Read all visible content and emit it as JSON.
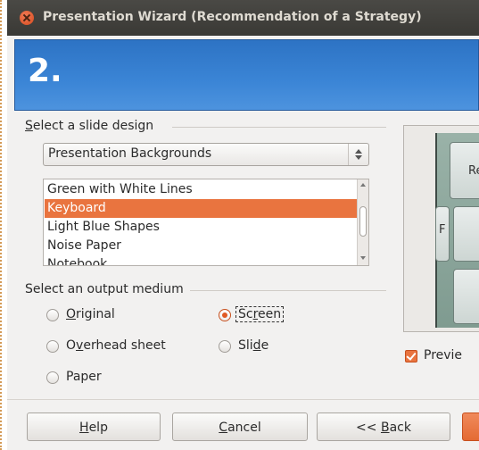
{
  "window": {
    "title": "Presentation Wizard (Recommendation of a Strategy)"
  },
  "banner": {
    "step": "2."
  },
  "slide_design": {
    "group_label": "Select a slide design",
    "group_label_mnemonic": "S",
    "group_label_rest": "elect a slide design",
    "category_selected": "Presentation Backgrounds",
    "items": [
      "Green with White Lines",
      "Keyboard",
      "Light Blue Shapes",
      "Noise Paper",
      "Notebook"
    ],
    "selected_item": "Keyboard"
  },
  "output_medium": {
    "group_label": "Select an output medium",
    "options": [
      {
        "label": "Original",
        "mnemonic": "O",
        "rest": "riginal",
        "checked": false
      },
      {
        "label": "Overhead sheet",
        "pre": "O",
        "mnemonic": "v",
        "rest": "erhead sheet",
        "checked": false
      },
      {
        "label": "Paper",
        "checked": false
      },
      {
        "label": "Screen",
        "pre": "Sc",
        "mnemonic": "r",
        "rest": "een",
        "checked": true
      },
      {
        "label": "Slide",
        "pre": "Sli",
        "mnemonic": "d",
        "rest": "e",
        "checked": false
      }
    ]
  },
  "preview": {
    "key_text_1": "Re",
    "key_text_2": "F",
    "checkbox_label": "Previe",
    "checkbox_checked": true
  },
  "buttons": {
    "help": {
      "mnemonic": "H",
      "rest": "elp"
    },
    "cancel": {
      "mnemonic": "C",
      "rest": "ancel"
    },
    "back": {
      "pre": "<< ",
      "mnemonic": "B",
      "rest": "ack"
    }
  },
  "colors": {
    "accent": "#e9743f",
    "banner": "#3b85d6",
    "titlebar": "#3c3b37"
  }
}
